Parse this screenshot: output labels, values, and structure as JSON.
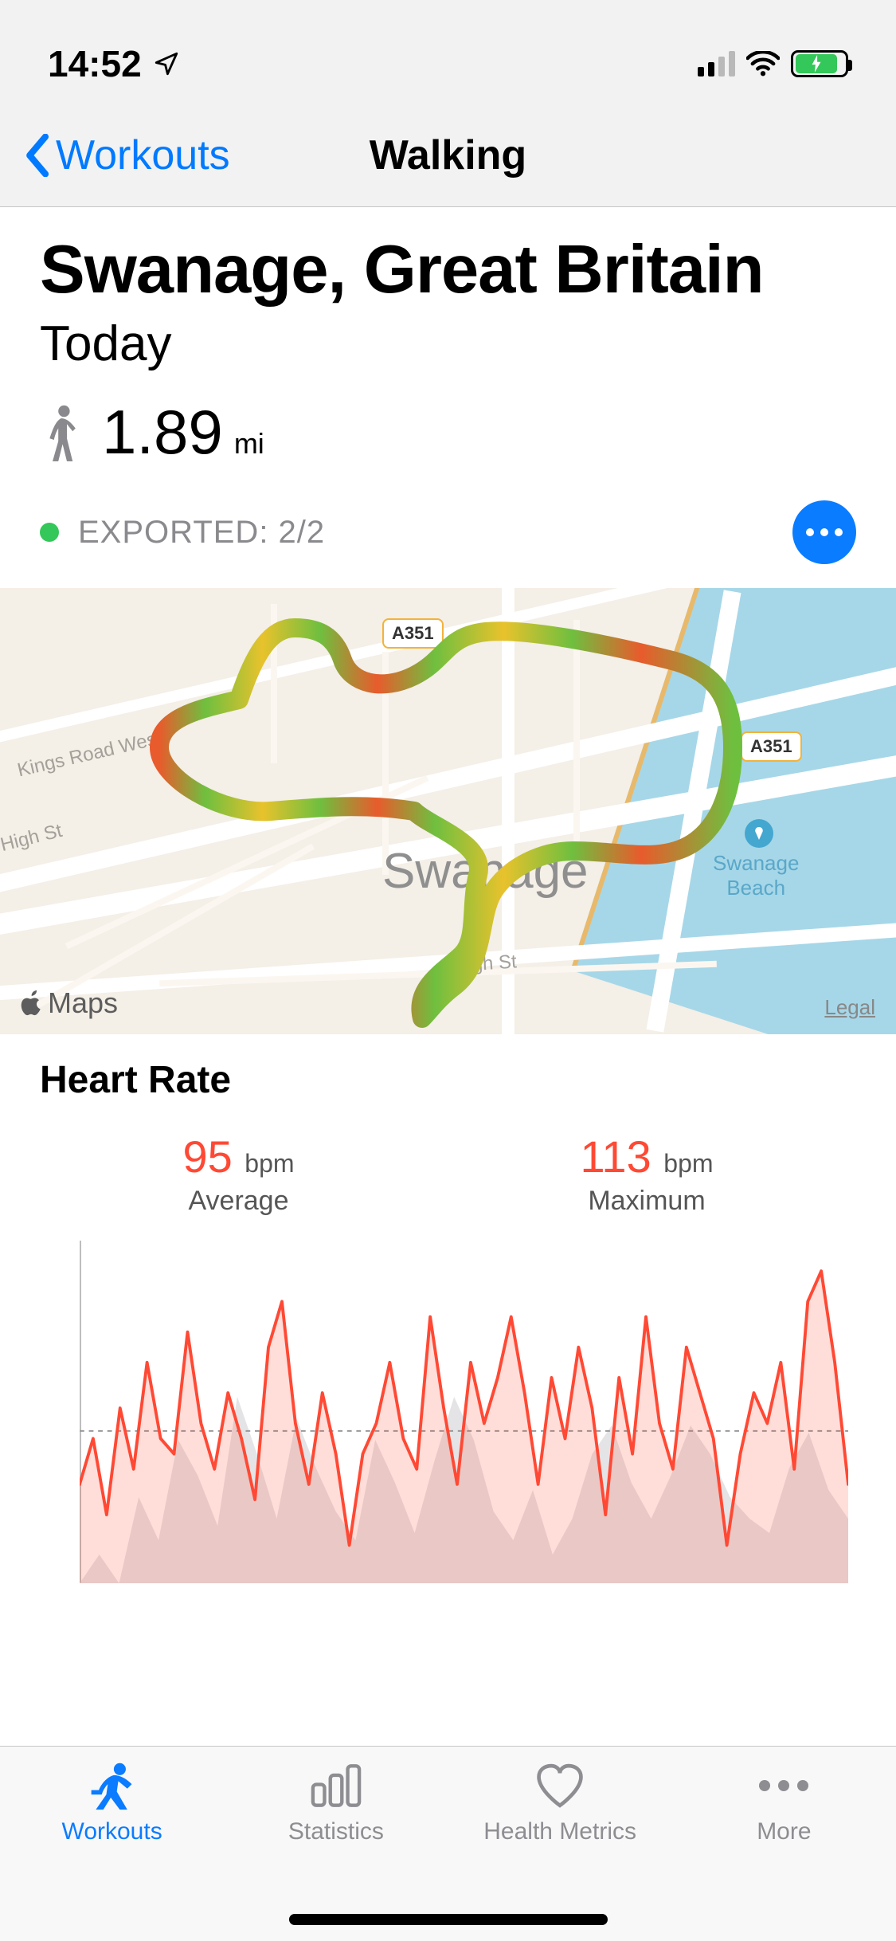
{
  "status_bar": {
    "time": "14:52",
    "signal_active_bars": 2,
    "battery_charging": true
  },
  "nav": {
    "back_label": "Workouts",
    "title": "Walking"
  },
  "summary": {
    "location": "Swanage, Great Britain",
    "date_label": "Today",
    "distance_value": "1.89",
    "distance_unit": "mi",
    "export_label": "EXPORTED: 2/2"
  },
  "map": {
    "city_label": "Swanage",
    "road_shield_1": "A351",
    "road_shield_2": "A351",
    "road_label_kings": "Kings Road West",
    "road_label_high": "High St",
    "beach_label_line1": "Swanage",
    "beach_label_line2": "Beach",
    "maps_attribution": "Maps",
    "legal_label": "Legal"
  },
  "heart_rate": {
    "title": "Heart Rate",
    "avg_value": "95",
    "avg_unit": "bpm",
    "avg_label": "Average",
    "max_value": "113",
    "max_unit": "bpm",
    "max_label": "Maximum"
  },
  "chart_data": {
    "type": "line",
    "title": "Heart Rate",
    "ylabel": "bpm",
    "avg_line": 95,
    "ylim": [
      75,
      120
    ],
    "series": [
      {
        "name": "Heart Rate",
        "values": [
          88,
          94,
          84,
          98,
          90,
          104,
          94,
          92,
          108,
          96,
          90,
          100,
          94,
          86,
          106,
          112,
          96,
          88,
          100,
          92,
          80,
          92,
          96,
          104,
          94,
          90,
          110,
          98,
          88,
          104,
          96,
          102,
          110,
          100,
          88,
          102,
          94,
          106,
          98,
          84,
          102,
          92,
          110,
          96,
          90,
          106,
          100,
          94,
          80,
          92,
          100,
          96,
          104,
          90,
          112,
          116,
          104,
          88
        ]
      }
    ]
  },
  "tabs": {
    "workouts": "Workouts",
    "statistics": "Statistics",
    "health_metrics": "Health Metrics",
    "more": "More"
  }
}
